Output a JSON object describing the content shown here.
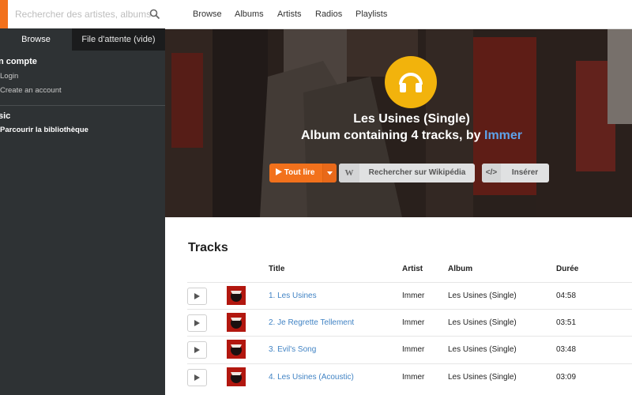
{
  "sidebar": {
    "logo_letter": "",
    "search_placeholder": "Rechercher des artistes, albums, piste",
    "tabs": {
      "browse": "Browse",
      "queue": "File d'attente (vide)"
    },
    "account": {
      "header": "n compte",
      "items": [
        "Login",
        "Create an account"
      ]
    },
    "music": {
      "header": "sic",
      "items": [
        "Parcourir la bibliothèque"
      ]
    }
  },
  "nav": {
    "items": [
      "Browse",
      "Albums",
      "Artists",
      "Radios",
      "Playlists"
    ]
  },
  "hero": {
    "icon": "headphones-icon",
    "title": "Les Usines (Single)",
    "subtitle_prefix": "Album containing 4 tracks, by ",
    "artist": "Immer",
    "play_label": "Tout lire",
    "wiki_icon": "W",
    "wiki_label": "Rechercher sur Wikipédia",
    "embed_icon": "</>",
    "embed_label": "Insérer"
  },
  "tracks": {
    "heading": "Tracks",
    "columns": {
      "title": "Title",
      "artist": "Artist",
      "album": "Album",
      "duration": "Durée"
    },
    "rows": [
      {
        "title": "1. Les Usines",
        "artist": "Immer",
        "album": "Les Usines (Single)",
        "duration": "04:58"
      },
      {
        "title": "2. Je Regrette Tellement",
        "artist": "Immer",
        "album": "Les Usines (Single)",
        "duration": "03:51"
      },
      {
        "title": "3. Evil's Song",
        "artist": "Immer",
        "album": "Les Usines (Single)",
        "duration": "03:48"
      },
      {
        "title": "4. Les Usines (Acoustic)",
        "artist": "Immer",
        "album": "Les Usines (Single)",
        "duration": "03:09"
      }
    ]
  },
  "colors": {
    "accent": "#f2711c",
    "sidebar": "#2e3234",
    "link": "#4183c4",
    "icon_circle": "#f2b30c"
  }
}
